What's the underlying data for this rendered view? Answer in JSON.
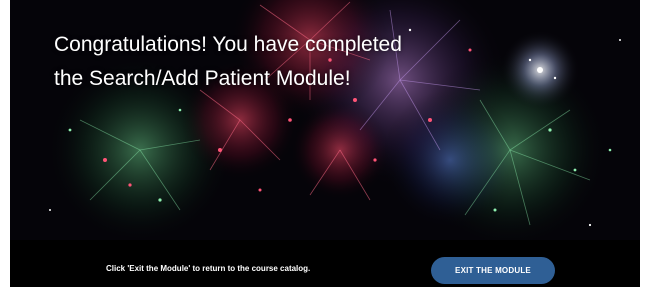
{
  "slide": {
    "headline": "Congratulations! You have completed the Search/Add Patient Module!",
    "background_image": "fireworks",
    "footer": {
      "instruction": "Click 'Exit the Module' to return to the course catalog.",
      "exit_button_label": "EXIT THE MODULE"
    }
  },
  "colors": {
    "slide_background": "#000000",
    "page_background": "#ffffff",
    "button_background": "#2f5f95",
    "text": "#ffffff"
  }
}
